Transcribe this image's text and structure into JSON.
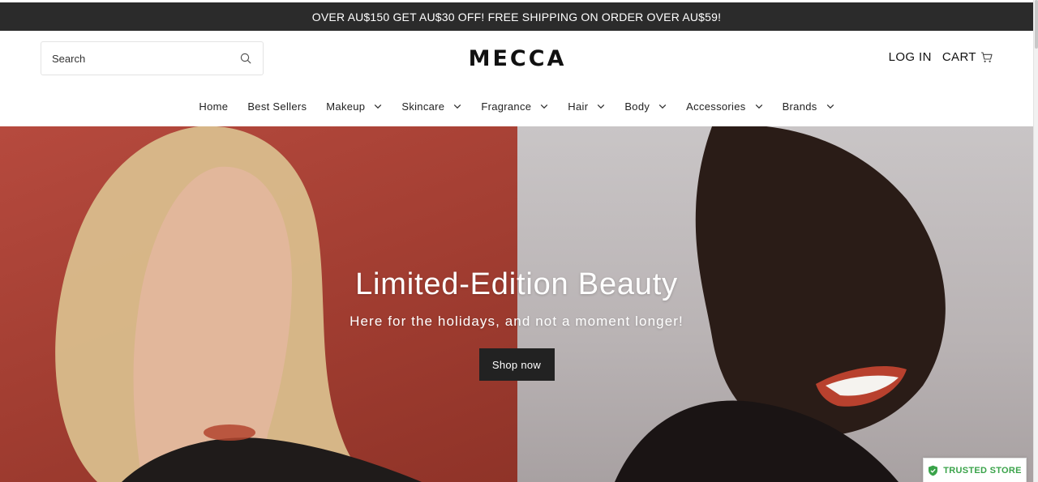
{
  "announcement": {
    "text": "OVER AU$150 GET AU$30 OFF! FREE SHIPPING ON ORDER OVER AU$59!"
  },
  "header": {
    "search": {
      "placeholder": "Search",
      "icon": "search-icon"
    },
    "logo": "MECCA",
    "login_label": "LOG IN",
    "cart_label": "CART",
    "cart_icon": "cart-icon"
  },
  "nav": {
    "items": [
      {
        "label": "Home",
        "has_dropdown": false
      },
      {
        "label": "Best Sellers",
        "has_dropdown": false
      },
      {
        "label": "Makeup",
        "has_dropdown": true
      },
      {
        "label": "Skincare",
        "has_dropdown": true
      },
      {
        "label": "Fragrance",
        "has_dropdown": true
      },
      {
        "label": "Hair",
        "has_dropdown": true
      },
      {
        "label": "Body",
        "has_dropdown": true
      },
      {
        "label": "Accessories",
        "has_dropdown": true
      },
      {
        "label": "Brands",
        "has_dropdown": true
      }
    ]
  },
  "hero": {
    "title": "Limited-Edition Beauty",
    "subtitle": "Here for the holidays, and not a moment longer!",
    "cta_label": "Shop now"
  },
  "trusted_badge": {
    "label": "TRUSTED STORE",
    "icon": "shield-check-icon"
  },
  "colors": {
    "announcement_bg": "#2b2b2b",
    "hero_left_bg": "#a13d31",
    "hero_right_bg": "#bdb7b8",
    "cta_bg": "#222222",
    "trusted_green": "#3aa34a"
  }
}
